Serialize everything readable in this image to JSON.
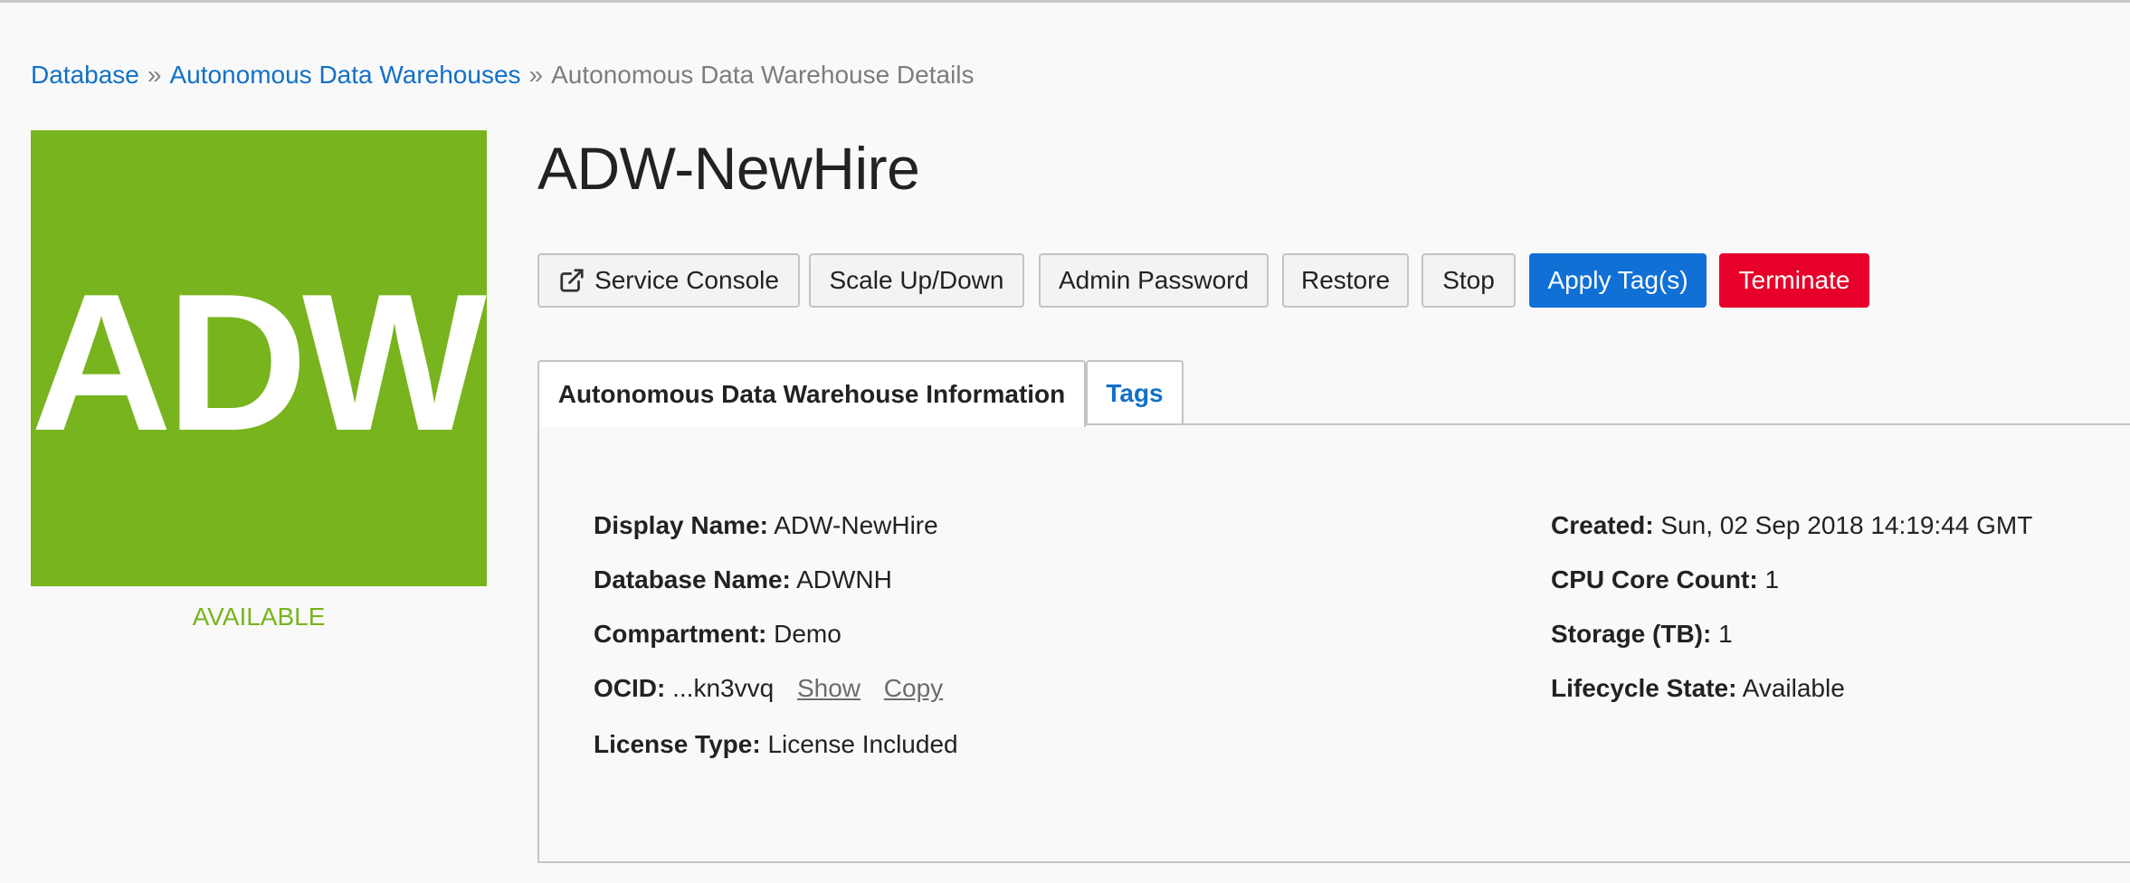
{
  "breadcrumb": {
    "items": [
      {
        "label": "Database"
      },
      {
        "label": "Autonomous Data Warehouses"
      }
    ],
    "separator": "»",
    "current": "Autonomous Data Warehouse Details"
  },
  "badge": {
    "text": "ADW",
    "status": "AVAILABLE",
    "color": "#78b41e"
  },
  "title": "ADW-NewHire",
  "actions": {
    "service_console": {
      "label": "Service Console",
      "icon": "external-link-icon"
    },
    "scale": {
      "label": "Scale Up/Down"
    },
    "admin_password": {
      "label": "Admin Password"
    },
    "restore": {
      "label": "Restore"
    },
    "stop": {
      "label": "Stop"
    },
    "apply_tags": {
      "label": "Apply Tag(s)",
      "color": "#1070d6"
    },
    "terminate": {
      "label": "Terminate",
      "color": "#e7002a"
    }
  },
  "tabs": [
    {
      "label": "Autonomous Data Warehouse Information",
      "active": true
    },
    {
      "label": "Tags",
      "active": false
    }
  ],
  "info": {
    "left": [
      {
        "label": "Display Name:",
        "value": "ADW-NewHire"
      },
      {
        "label": "Database Name:",
        "value": "ADWNH"
      },
      {
        "label": "Compartment:",
        "value": "Demo"
      },
      {
        "label": "OCID:",
        "value": "...kn3vvq",
        "show_link": "Show",
        "copy_link": "Copy"
      },
      {
        "label": "License Type:",
        "value": "License Included"
      }
    ],
    "right": [
      {
        "label": "Created:",
        "value": "Sun, 02 Sep 2018 14:19:44 GMT"
      },
      {
        "label": "CPU Core Count:",
        "value": "1"
      },
      {
        "label": "Storage (TB):",
        "value": "1"
      },
      {
        "label": "Lifecycle State:",
        "value": "Available"
      }
    ]
  }
}
